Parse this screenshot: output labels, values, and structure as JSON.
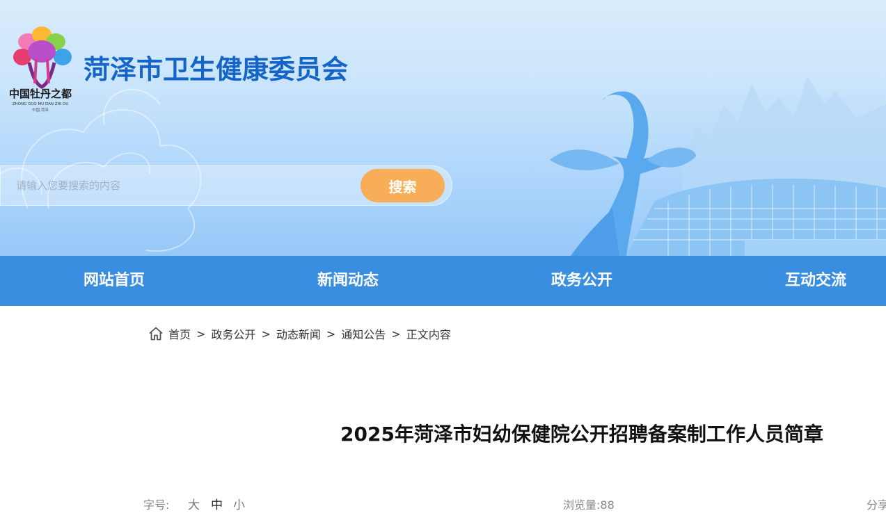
{
  "header": {
    "logo": {
      "text_cn": "中国牡丹之都",
      "text_pinyin": "ZHONG GUO MU DAN ZHI DU",
      "text_small": "中国·菏泽"
    },
    "site_title": "菏泽市卫生健康委员会",
    "search": {
      "placeholder": "请输入您要搜索的内容",
      "button_label": "搜索"
    }
  },
  "nav": {
    "items": [
      {
        "label": "网站首页"
      },
      {
        "label": "新闻动态"
      },
      {
        "label": "政务公开"
      },
      {
        "label": "互动交流"
      }
    ]
  },
  "breadcrumb": {
    "items": [
      "首页",
      "政务公开",
      "动态新闻",
      "通知公告",
      "正文内容"
    ],
    "separator": ">"
  },
  "article": {
    "title": "2025年菏泽市妇幼保健院公开招聘备案制工作人员简章",
    "font_size_label": "字号:",
    "font_sizes": [
      "大",
      "中",
      "小"
    ],
    "font_size_selected": "中",
    "views_label": "浏览量:",
    "views_count": "88",
    "share_label": "分享"
  },
  "colors": {
    "title_blue": "#1565c9",
    "nav_bg": "#3a8ee0",
    "search_button": "#f8ae58",
    "banner_light": "#d9ecfb",
    "banner_dark": "#98c8f8"
  }
}
